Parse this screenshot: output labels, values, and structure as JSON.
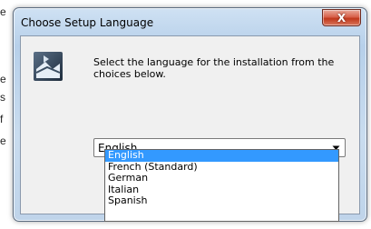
{
  "background": {
    "fragments": [
      "e",
      "e",
      "s",
      "f",
      "e"
    ]
  },
  "window": {
    "title": "Choose Setup Language",
    "close_glyph": "X"
  },
  "dialog": {
    "icon": "setup-icon",
    "prompt": "Select the language for the installation from the choices below."
  },
  "language_select": {
    "value": "English",
    "options": [
      {
        "label": "English",
        "selected": true
      },
      {
        "label": "French (Standard)",
        "selected": false
      },
      {
        "label": "German",
        "selected": false
      },
      {
        "label": "Italian",
        "selected": false
      },
      {
        "label": "Spanish",
        "selected": false
      }
    ]
  },
  "colors": {
    "highlight": "#3399ff",
    "close_button": "#c0381c"
  }
}
